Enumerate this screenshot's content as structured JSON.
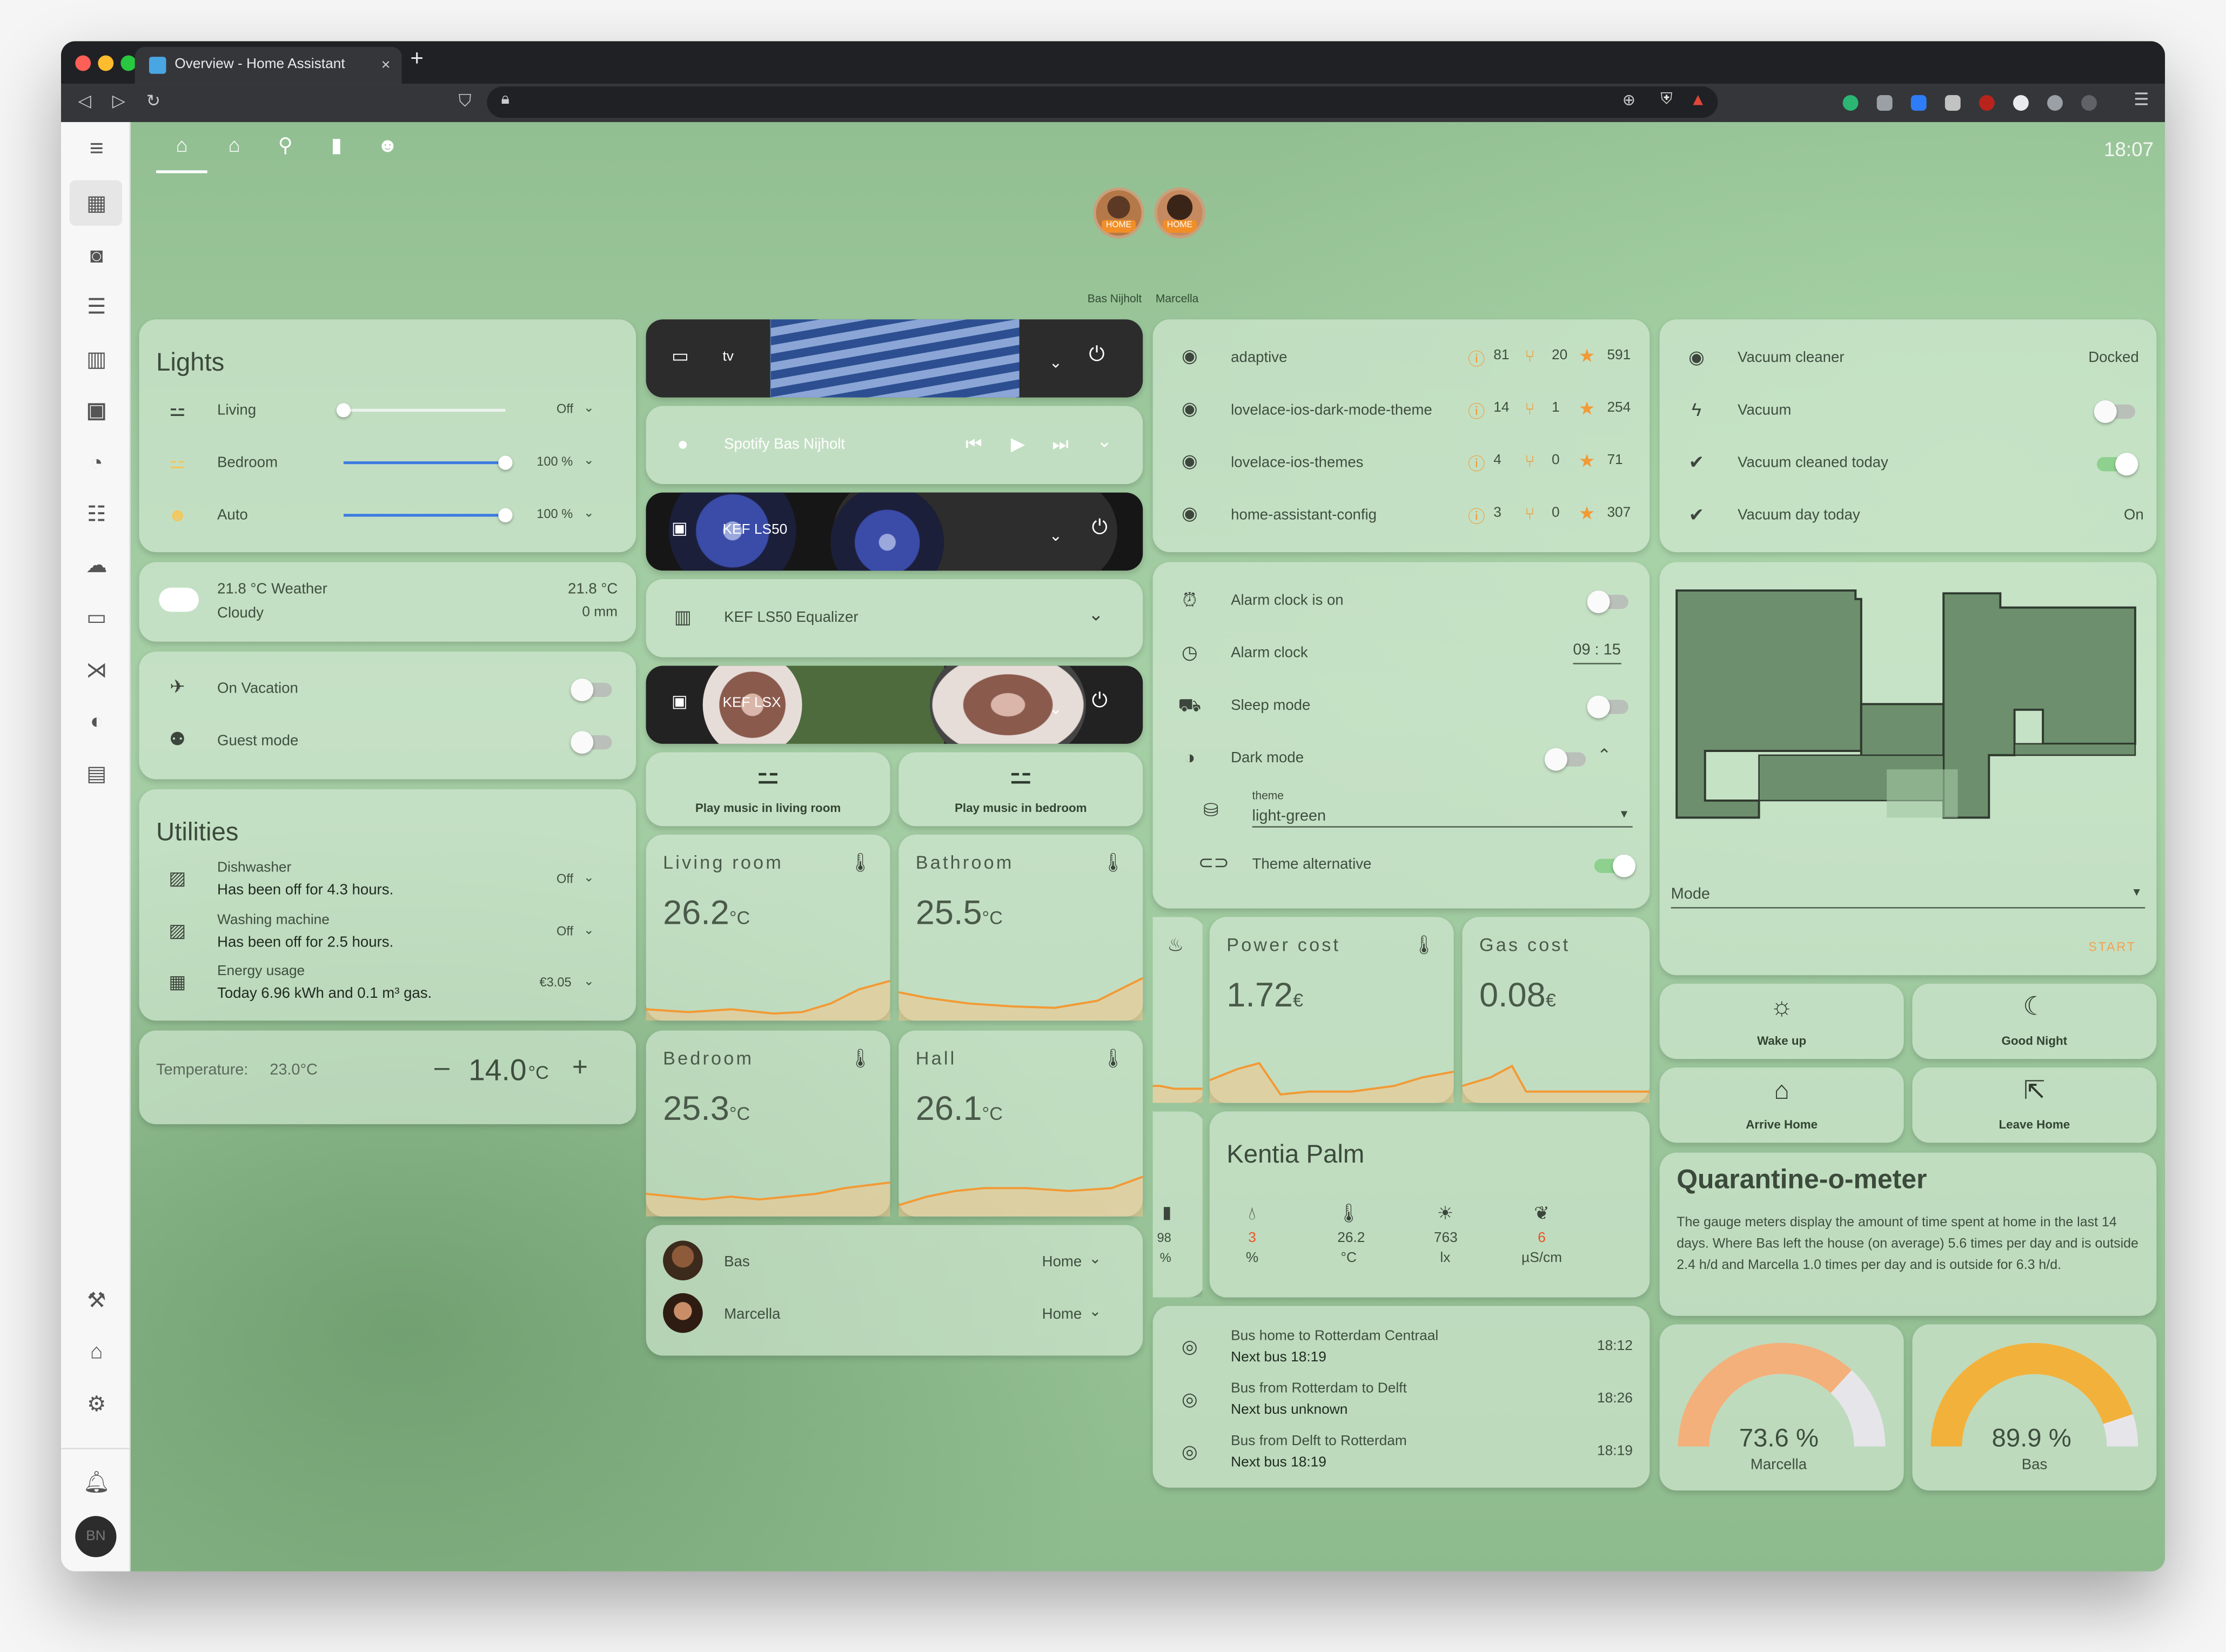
{
  "browser": {
    "tab_title": "Overview - Home Assistant",
    "tab_close": "×",
    "new_tab": "+"
  },
  "header": {
    "clock": "18:07"
  },
  "people_badges": [
    {
      "name": "Bas Nijholt",
      "state": "HOME"
    },
    {
      "name": "Marcella",
      "state": "HOME"
    }
  ],
  "lights": {
    "title": "Lights",
    "rows": [
      {
        "name": "Living",
        "state": "Off",
        "level": 0
      },
      {
        "name": "Bedroom",
        "state": "100 %",
        "level": 100
      },
      {
        "name": "Auto",
        "state": "100 %",
        "level": 100
      }
    ]
  },
  "weather": {
    "title": "21.8 °C Weather",
    "condition": "Cloudy",
    "temp": "21.8 °C",
    "precip": "0 mm"
  },
  "modes": [
    {
      "name": "On Vacation",
      "on": false
    },
    {
      "name": "Guest mode",
      "on": false
    }
  ],
  "utilities": {
    "title": "Utilities",
    "rows": [
      {
        "name": "Dishwasher",
        "detail": "Has been off for 4.3 hours.",
        "state": "Off"
      },
      {
        "name": "Washing machine",
        "detail": "Has been off for 2.5 hours.",
        "state": "Off"
      },
      {
        "name": "Energy usage",
        "detail": "Today 6.96 kWh and 0.1 m³ gas.",
        "state": "€3.05"
      }
    ]
  },
  "thermostat": {
    "label": "Temperature:",
    "current": "23.0°C",
    "minus": "–",
    "target": "14.0",
    "unit": "°C",
    "plus": "+"
  },
  "media": {
    "tv": "tv",
    "spotify": "Spotify Bas Nijholt",
    "kef_ls50": "KEF LS50",
    "equalizer": "KEF LS50 Equalizer",
    "kef_lsx": "KEF LSX"
  },
  "scenes_music": [
    {
      "label": "Play music in living room"
    },
    {
      "label": "Play music in bedroom"
    }
  ],
  "temp_sensors": [
    {
      "name": "Living room",
      "value": "26.2",
      "unit": "°C"
    },
    {
      "name": "Bathroom",
      "value": "25.5",
      "unit": "°C"
    },
    {
      "name": "Bedroom",
      "value": "25.3",
      "unit": "°C"
    },
    {
      "name": "Hall",
      "value": "26.1",
      "unit": "°C"
    }
  ],
  "persons": [
    {
      "name": "Bas",
      "state": "Home"
    },
    {
      "name": "Marcella",
      "state": "Home"
    }
  ],
  "github": [
    {
      "repo": "adaptive",
      "issues": "81",
      "prs": "20",
      "stars": "591"
    },
    {
      "repo": "lovelace-ios-dark-mode-theme",
      "issues": "14",
      "prs": "1",
      "stars": "254"
    },
    {
      "repo": "lovelace-ios-themes",
      "issues": "4",
      "prs": "0",
      "stars": "71"
    },
    {
      "repo": "home-assistant-config",
      "issues": "3",
      "prs": "0",
      "stars": "307"
    }
  ],
  "settings": {
    "alarm_on": "Alarm clock is on",
    "alarm_clock": "Alarm clock",
    "alarm_time": "09 : 15",
    "sleep_mode": "Sleep mode",
    "dark_mode": "Dark mode",
    "theme_label": "theme",
    "theme_value": "light-green",
    "theme_alt": "Theme alternative"
  },
  "cost_sensors": [
    {
      "name": "Power cost",
      "value": "1.72",
      "unit": "€"
    },
    {
      "name": "Gas cost",
      "value": "0.08",
      "unit": "€"
    }
  ],
  "plant": {
    "title": "Kentia Palm",
    "battery": "98",
    "battery_unit": "%",
    "metrics": [
      {
        "value": "3",
        "unit": "%",
        "alert": true,
        "icon": "water-drop-icon"
      },
      {
        "value": "26.2",
        "unit": "°C",
        "alert": false,
        "icon": "thermometer-icon"
      },
      {
        "value": "763",
        "unit": "lx",
        "alert": false,
        "icon": "sun-icon"
      },
      {
        "value": "6",
        "unit": "µS/cm",
        "alert": true,
        "icon": "fertilizer-icon"
      }
    ]
  },
  "buses": [
    {
      "route": "Bus home to Rotterdam Centraal",
      "next": "Next bus 18:19",
      "time": "18:12"
    },
    {
      "route": "Bus from Rotterdam to Delft",
      "next": "Next bus unknown",
      "time": "18:26"
    },
    {
      "route": "Bus from Delft to Rotterdam",
      "next": "Next bus 18:19",
      "time": "18:19"
    }
  ],
  "vacuum": [
    {
      "name": "Vacuum cleaner",
      "state": "Docked"
    },
    {
      "name": "Vacuum",
      "state": ""
    },
    {
      "name": "Vacuum cleaned today",
      "state": ""
    },
    {
      "name": "Vacuum day today",
      "state": "On"
    }
  ],
  "map": {
    "mode_label": "Mode",
    "start": "START"
  },
  "scenes_home": [
    {
      "label": "Wake up",
      "icon": "sunrise-icon"
    },
    {
      "label": "Good Night",
      "icon": "moon-icon"
    },
    {
      "label": "Arrive Home",
      "icon": "home-icon"
    },
    {
      "label": "Leave Home",
      "icon": "home-export-icon"
    }
  ],
  "quarantine": {
    "title": "Quarantine-o-meter",
    "text": "The gauge meters display the amount of time spent at home in the last 14 days. Where Bas left the house (on average) 5.6 times per day and is outside 2.4 h/d and Marcella 1.0 times per day and is outside for 6.3 h/d."
  },
  "gauges": [
    {
      "name": "Marcella",
      "value": "73.6 %",
      "fraction": 0.736,
      "color": "#f3b07a"
    },
    {
      "name": "Bas",
      "value": "89.9 %",
      "fraction": 0.899,
      "color": "#f2b13a"
    }
  ],
  "colors": {
    "accent_orange": "#f29a35",
    "toggle_on": "#8ed08e",
    "slider_blue": "#3d7ce0",
    "alert": "#e8542a"
  }
}
